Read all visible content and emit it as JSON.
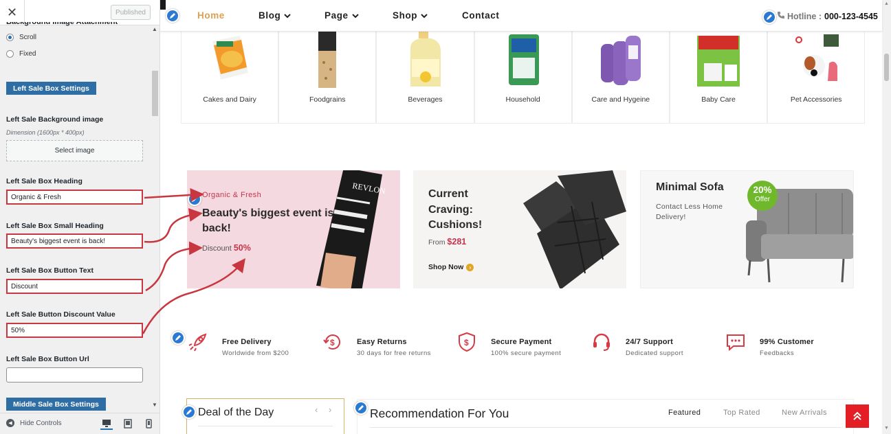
{
  "panel": {
    "published_label": "Published",
    "cut_heading": "Background Image Attachment",
    "radio_options": [
      "Scroll",
      "Fixed"
    ],
    "radio_selected": "Scroll",
    "section_left": "Left Sale Box Settings",
    "bg_image_label": "Left Sale Background image",
    "bg_image_desc": "Dimension (1600px * 400px)",
    "select_image_label": "Select image",
    "heading_label": "Left Sale Box Heading",
    "heading_value": "Organic & Fresh",
    "small_heading_label": "Left Sale Box Small Heading",
    "small_heading_value": "Beauty's biggest event is back!",
    "button_text_label": "Left Sale Box Button Text",
    "button_text_value": "Discount",
    "discount_label": "Left Sale Button Discount Value",
    "discount_value": "50%",
    "button_url_label": "Left Sale Box Button Url",
    "button_url_value": "",
    "section_middle": "Middle Sale Box Settings",
    "hide_controls": "Hide Controls"
  },
  "nav": {
    "items": [
      {
        "label": "Home",
        "active": true,
        "dropdown": false
      },
      {
        "label": "Blog",
        "active": false,
        "dropdown": true
      },
      {
        "label": "Page",
        "active": false,
        "dropdown": true
      },
      {
        "label": "Shop",
        "active": false,
        "dropdown": true
      },
      {
        "label": "Contact",
        "active": false,
        "dropdown": false
      }
    ],
    "hotline_label": "Hotline :",
    "hotline_number": "000-123-4545"
  },
  "categories": [
    {
      "label": "Cakes and Dairy",
      "icon": "mac-cheese-box"
    },
    {
      "label": "Foodgrains",
      "icon": "grain-bag"
    },
    {
      "label": "Beverages",
      "icon": "juice-jug"
    },
    {
      "label": "Household",
      "icon": "cleaner-pack"
    },
    {
      "label": "Care and Hygeine",
      "icon": "wash-bottles"
    },
    {
      "label": "Baby Care",
      "icon": "diaper-pack"
    },
    {
      "label": "Pet Accessories",
      "icon": "pet-items"
    }
  ],
  "sale_left": {
    "kicker": "Organic & Fresh",
    "title": "Beauty's biggest event is back!",
    "discount_text": "Discount",
    "discount_value": "50%",
    "product_brand": "REVLON"
  },
  "sale_middle": {
    "title": "Current Craving: Cushions!",
    "from_label": "From",
    "price": "$281",
    "shop_label": "Shop Now"
  },
  "sale_right": {
    "title": "Minimal Sofa",
    "subtitle": "Contact Less Home Delivery!",
    "badge_pct": "20%",
    "badge_text": "Offer"
  },
  "features": [
    {
      "title": "Free Delivery",
      "sub": "Worldwide from $200",
      "icon": "rocket-icon"
    },
    {
      "title": "Easy Returns",
      "sub": "30 days for free returns",
      "icon": "returns-icon"
    },
    {
      "title": "Secure Payment",
      "sub": "100% secure payment",
      "icon": "shield-icon"
    },
    {
      "title": "24/7 Support",
      "sub": "Dedicated support",
      "icon": "headset-icon"
    },
    {
      "title": "99% Customer",
      "sub": "Feedbacks",
      "icon": "chat-icon"
    }
  ],
  "deal": {
    "title": "Deal of the Day"
  },
  "reco": {
    "title": "Recommendation For You",
    "tabs": [
      "Featured",
      "Top Rated",
      "New Arrivals"
    ]
  },
  "colors": {
    "accent": "#d9a152",
    "sale_red": "#c7344a",
    "panel_blue": "#2f6ea5",
    "annotation_red": "#c8363f",
    "badge_green": "#6fb82c",
    "top_button_red": "#e31e24"
  }
}
